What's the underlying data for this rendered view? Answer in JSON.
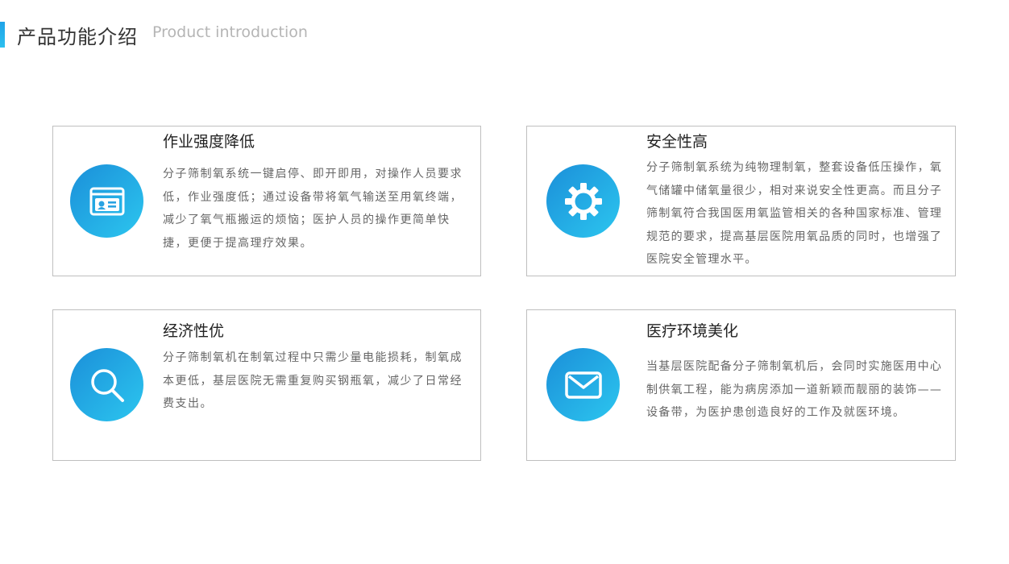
{
  "header": {
    "title_cn": "产品功能介绍",
    "title_en": "Product introduction"
  },
  "colors": {
    "accent": "#1fa3e8",
    "gradient_start": "#1b8fd9",
    "gradient_end": "#2cc6ef"
  },
  "features": [
    {
      "title": "作业强度降低",
      "icon": "id-card-icon",
      "description": "分子筛制氧系统一键启停、即开即用，对操作人员要求低，作业强度低；通过设备带将氧气输送至用氧终端，减少了氧气瓶搬运的烦恼；医护人员的操作更简单快捷，更便于提高理疗效果。"
    },
    {
      "title": "安全性高",
      "icon": "gear-icon",
      "description": "分子筛制氧系统为纯物理制氧，整套设备低压操作，氧气储罐中储氧量很少，相对来说安全性更高。而且分子筛制氧符合我国医用氧监管相关的各种国家标准、管理规范的要求，提高基层医院用氧品质的同时，也增强了医院安全管理水平。"
    },
    {
      "title": "经济性优",
      "icon": "search-icon",
      "description": "分子筛制氧机在制氧过程中只需少量电能损耗，制氧成本更低，基层医院无需重复购买钢瓶氧，减少了日常经费支出。"
    },
    {
      "title": "医疗环境美化",
      "icon": "mail-icon",
      "description": "当基层医院配备分子筛制氧机后，会同时实施医用中心制供氧工程，能为病房添加一道新颖而靓丽的装饰——设备带，为医护患创造良好的工作及就医环境。"
    }
  ]
}
